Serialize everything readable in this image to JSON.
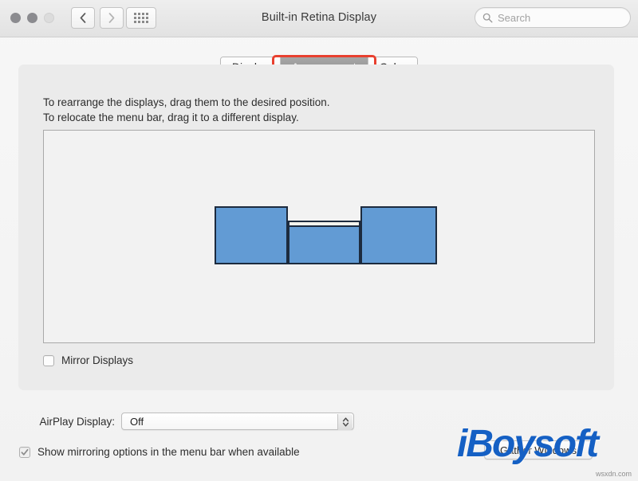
{
  "window": {
    "title": "Built-in Retina Display",
    "traffic_lights": [
      "close",
      "minimize",
      "zoom"
    ],
    "nav_back_icon": "chevron-left-icon",
    "nav_forward_icon": "chevron-right-icon",
    "show_all_icon": "grid-dots-icon"
  },
  "search": {
    "placeholder": "Search",
    "icon": "search-icon",
    "value": ""
  },
  "tabs": [
    {
      "label": "Display",
      "selected": false
    },
    {
      "label": "Arrangement",
      "selected": true
    },
    {
      "label": "Color",
      "selected": false
    }
  ],
  "highlight": {
    "target": "Arrangement",
    "color": "#e8402f"
  },
  "instructions": {
    "line1": "To rearrange the displays, drag them to the desired position.",
    "line2": "To relocate the menu bar, drag it to a different display."
  },
  "arrangement": {
    "display_color": "#629bd4",
    "display_border_color": "#1d2b3e",
    "menubar_color": "#f4f4ee",
    "displays": [
      {
        "name": "left-display",
        "has_menu_bar": false
      },
      {
        "name": "center-display",
        "has_menu_bar": true
      },
      {
        "name": "right-display",
        "has_menu_bar": false
      }
    ]
  },
  "mirror": {
    "label": "Mirror Displays",
    "checked": false
  },
  "airplay": {
    "label": "AirPlay Display:",
    "value": "Off",
    "stepper_icon": "chevron-up-down-icon"
  },
  "show_mirroring": {
    "label": "Show mirroring options in the menu bar when available",
    "checked": true
  },
  "gather": {
    "label": "Gather Windows"
  },
  "watermark": {
    "brand": "iBoysoft",
    "url": "wsxdn.com"
  }
}
